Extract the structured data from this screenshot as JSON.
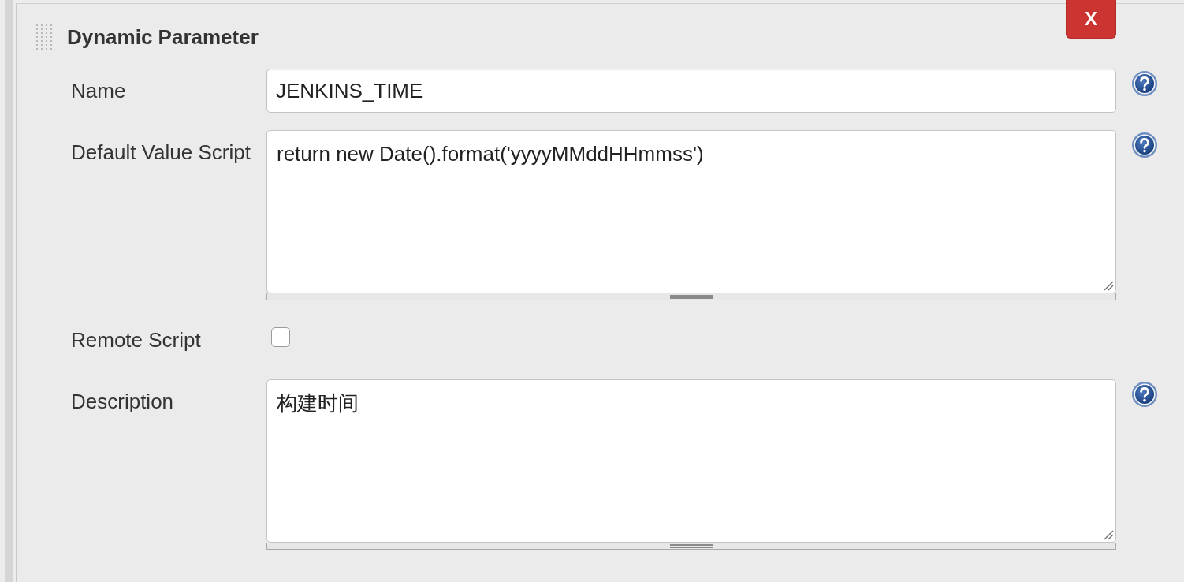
{
  "section": {
    "title": "Dynamic Parameter",
    "close_label": "X"
  },
  "fields": [
    {
      "kind": "text",
      "label": "Name",
      "value": "JENKINS_TIME",
      "help": true
    },
    {
      "kind": "textarea",
      "label": "Default Value Script",
      "value": "return new Date().format('yyyyMMddHHmmss')",
      "help": true
    },
    {
      "kind": "checkbox",
      "label": "Remote Script",
      "checked": false
    },
    {
      "kind": "textarea",
      "label": "Description",
      "value": "构建时间",
      "help": true
    }
  ]
}
